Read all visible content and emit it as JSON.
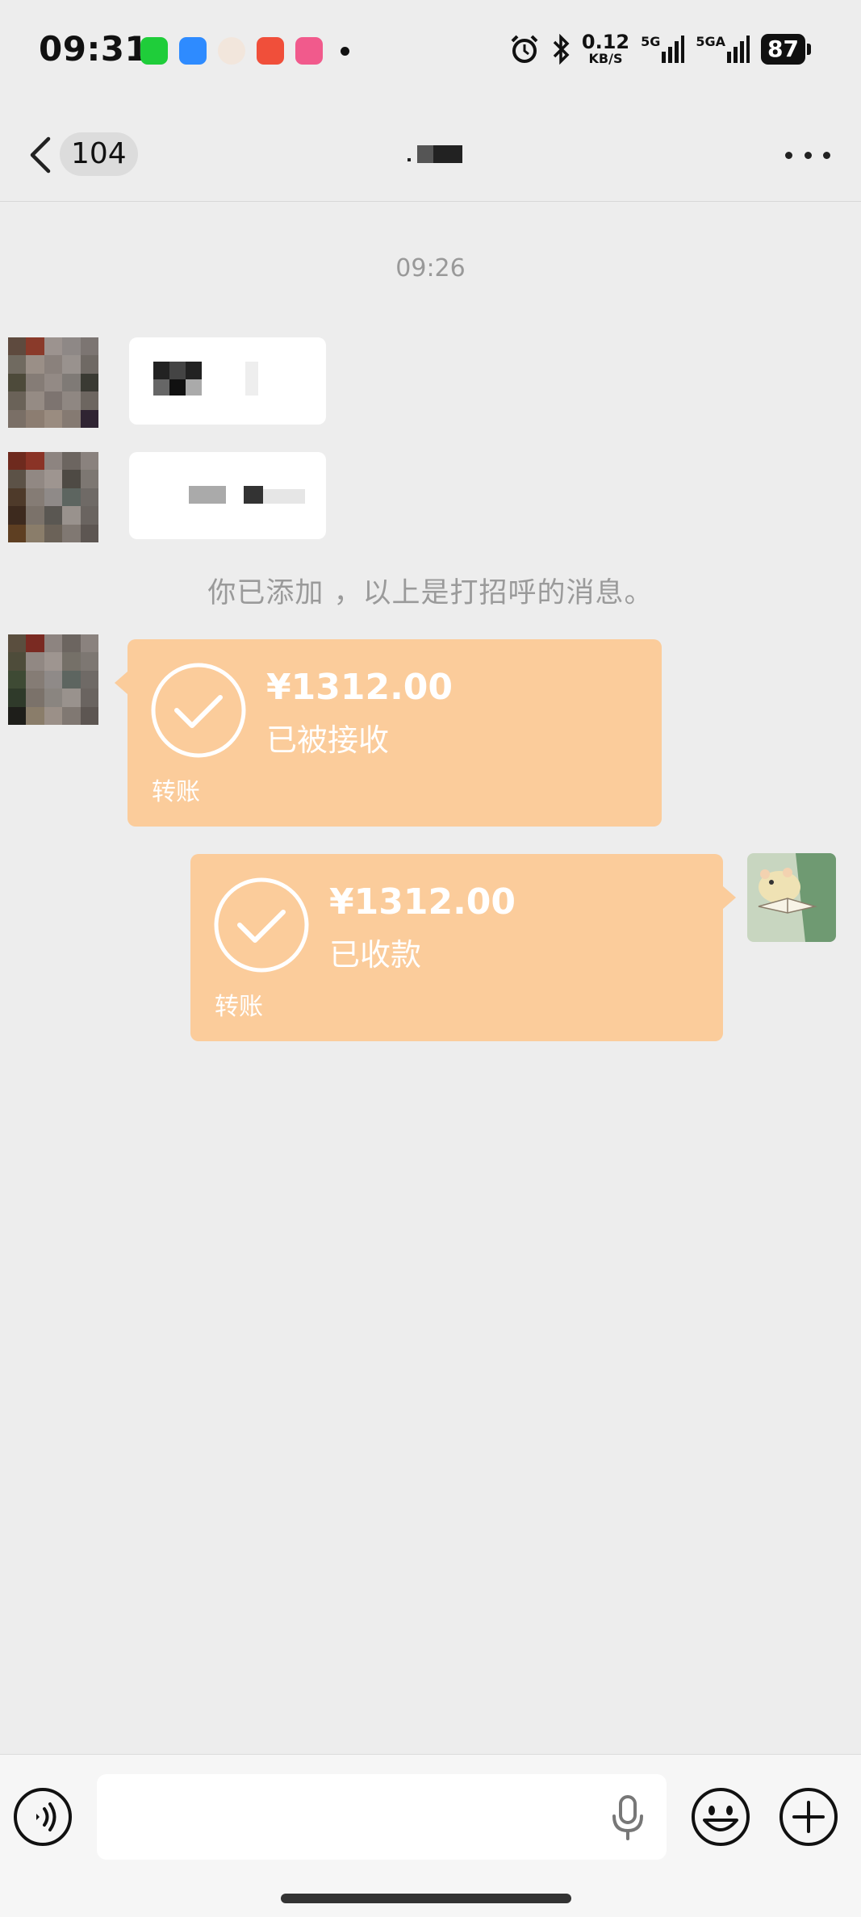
{
  "status_bar": {
    "time": "09:31",
    "net_speed_value": "0.12",
    "net_speed_unit": "KB/S",
    "signal1_label": "5G",
    "signal2_label": "5GA",
    "battery": "87"
  },
  "nav": {
    "unread_count": "104"
  },
  "chat": {
    "timestamp": "09:26",
    "system_message": "你已添加 ，以上是打招呼的消息。",
    "incoming_transfer": {
      "amount": "¥1312.00",
      "status": "已被接收",
      "label": "转账"
    },
    "outgoing_transfer": {
      "amount": "¥1312.00",
      "status": "已收款",
      "label": "转账"
    }
  },
  "input": {
    "placeholder": ""
  },
  "colors": {
    "transfer_bg": "#fbcc9b",
    "chat_bg": "#ededed",
    "accent_apps": [
      "#1fcd3a",
      "#2e8bff",
      "#f04f3a",
      "#f15a8c"
    ]
  },
  "icons": [
    "back-arrow-icon",
    "more-icon",
    "voice-mode-icon",
    "mic-icon",
    "emoji-icon",
    "plus-icon",
    "check-circle-icon",
    "alarm-icon",
    "bluetooth-icon",
    "signal-icon",
    "battery-icon"
  ]
}
